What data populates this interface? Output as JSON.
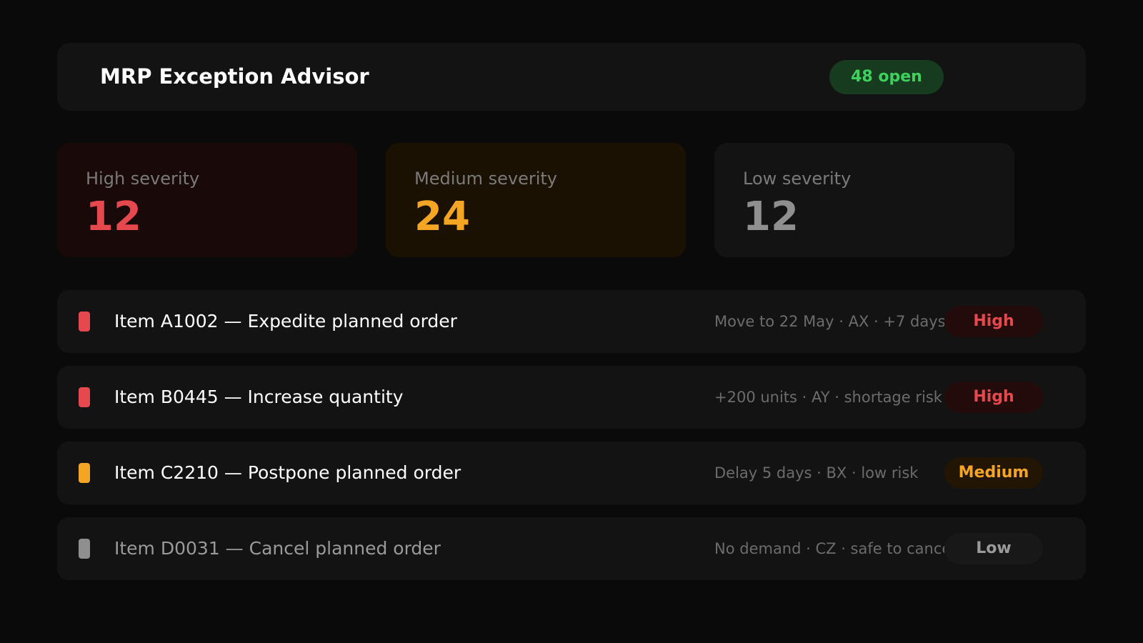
{
  "header": {
    "title": "MRP Exception Advisor",
    "open_badge": "48 open"
  },
  "colors": {
    "high": "#e5484d",
    "medium": "#f5a524",
    "low": "#8f8f8f",
    "open_green": "#3fd15d"
  },
  "summary": [
    {
      "label": "High severity",
      "value": "12"
    },
    {
      "label": "Medium severity",
      "value": "24"
    },
    {
      "label": "Low severity",
      "value": "12"
    }
  ],
  "exceptions": [
    {
      "title": "Item A1002 — Expedite planned order",
      "detail": "Move to 22 May · AX · +7 days",
      "severity": "High"
    },
    {
      "title": "Item B0445 — Increase quantity",
      "detail": "+200 units · AY · shortage risk",
      "severity": "High"
    },
    {
      "title": "Item C2210 — Postpone planned order",
      "detail": "Delay 5 days · BX · low risk",
      "severity": "Medium"
    },
    {
      "title": "Item D0031 — Cancel planned order",
      "detail": "No demand · CZ · safe to cancel",
      "severity": "Low"
    }
  ]
}
